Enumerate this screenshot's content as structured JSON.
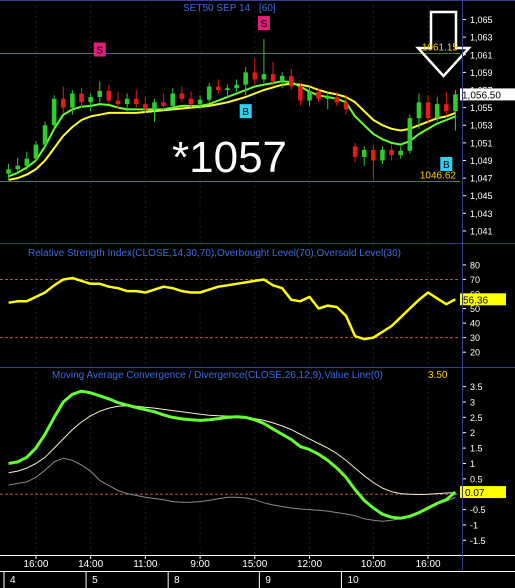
{
  "colors": {
    "background": "#000000",
    "frame": "#3a3f8f",
    "price_candle_up": "#2ecc2e",
    "price_candle_down": "#e61a1a",
    "ma_fast": "#66ff33",
    "ma_slow": "#ffff33",
    "level_line": "#4b5bd6",
    "rsi_line": "#ffff00",
    "rsi_level": "#b55050",
    "macd_line": "#66ff33",
    "macd_signal": "#f2f2d0",
    "macd_hist": "#8a8a8a",
    "title_text": "#3d6be0",
    "axis_text": "#ffffff",
    "grid": "#202020",
    "sell_marker": "#e0207a",
    "buy_marker": "#30d0f0",
    "value_badge_bg": "#ffff00",
    "value_badge_text": "#000000"
  },
  "chart_data": [
    {
      "id": "price",
      "type": "candlestick",
      "title": "SET50 SEP 14",
      "interval_label": "[60]",
      "ylim": [
        1040.2,
        1065.4
      ],
      "yticks": [
        "1,065",
        "1,063",
        "1,061",
        "1,059",
        "1,057",
        "1,055",
        "1,053",
        "1,051",
        "1,049",
        "1,047",
        "1,045",
        "1,043",
        "1,041"
      ],
      "ytick_values": [
        1065,
        1063,
        1061,
        1059,
        1057,
        1055,
        1053,
        1051,
        1049,
        1047,
        1045,
        1043,
        1041
      ],
      "upper_level": 1061.15,
      "upper_level_label": "1061.15",
      "lower_level": 1046.62,
      "lower_level_label": "1046.62",
      "last_value_label": "1,056.50",
      "big_annotation": "*1057",
      "candles": [
        {
          "o": 1047.5,
          "h": 1048.6,
          "l": 1046.9,
          "c": 1048.0
        },
        {
          "o": 1048.0,
          "h": 1049.3,
          "l": 1047.5,
          "c": 1048.4
        },
        {
          "o": 1048.4,
          "h": 1050.0,
          "l": 1047.9,
          "c": 1049.2
        },
        {
          "o": 1049.2,
          "h": 1051.2,
          "l": 1048.9,
          "c": 1050.8
        },
        {
          "o": 1050.8,
          "h": 1053.4,
          "l": 1050.3,
          "c": 1053.0
        },
        {
          "o": 1053.0,
          "h": 1056.4,
          "l": 1052.6,
          "c": 1056.0
        },
        {
          "o": 1056.0,
          "h": 1057.4,
          "l": 1054.4,
          "c": 1055.0
        },
        {
          "o": 1055.0,
          "h": 1057.0,
          "l": 1054.2,
          "c": 1056.6
        },
        {
          "o": 1056.6,
          "h": 1057.2,
          "l": 1055.0,
          "c": 1055.6
        },
        {
          "o": 1055.6,
          "h": 1056.6,
          "l": 1054.6,
          "c": 1056.2
        },
        {
          "o": 1056.2,
          "h": 1058.0,
          "l": 1055.6,
          "c": 1056.9
        },
        {
          "o": 1056.9,
          "h": 1057.6,
          "l": 1055.4,
          "c": 1055.8
        },
        {
          "o": 1055.8,
          "h": 1056.8,
          "l": 1054.8,
          "c": 1055.4
        },
        {
          "o": 1055.4,
          "h": 1056.6,
          "l": 1054.6,
          "c": 1056.0
        },
        {
          "o": 1056.0,
          "h": 1057.0,
          "l": 1055.0,
          "c": 1055.4
        },
        {
          "o": 1055.4,
          "h": 1056.2,
          "l": 1054.4,
          "c": 1054.8
        },
        {
          "o": 1054.8,
          "h": 1056.0,
          "l": 1053.4,
          "c": 1055.6
        },
        {
          "o": 1055.6,
          "h": 1056.6,
          "l": 1054.8,
          "c": 1055.2
        },
        {
          "o": 1055.2,
          "h": 1057.2,
          "l": 1054.9,
          "c": 1056.6
        },
        {
          "o": 1056.6,
          "h": 1057.4,
          "l": 1055.6,
          "c": 1056.0
        },
        {
          "o": 1056.0,
          "h": 1056.8,
          "l": 1055.0,
          "c": 1055.4
        },
        {
          "o": 1055.4,
          "h": 1056.4,
          "l": 1054.8,
          "c": 1055.9
        },
        {
          "o": 1055.9,
          "h": 1057.8,
          "l": 1055.6,
          "c": 1057.4
        },
        {
          "o": 1057.4,
          "h": 1058.2,
          "l": 1056.6,
          "c": 1057.0
        },
        {
          "o": 1057.0,
          "h": 1057.6,
          "l": 1056.2,
          "c": 1057.2
        },
        {
          "o": 1057.2,
          "h": 1058.2,
          "l": 1056.8,
          "c": 1057.6
        },
        {
          "o": 1057.6,
          "h": 1059.6,
          "l": 1056.4,
          "c": 1059.0
        },
        {
          "o": 1059.0,
          "h": 1060.6,
          "l": 1057.6,
          "c": 1058.2
        },
        {
          "o": 1058.2,
          "h": 1062.8,
          "l": 1057.8,
          "c": 1058.8
        },
        {
          "o": 1058.8,
          "h": 1060.2,
          "l": 1057.4,
          "c": 1058.0
        },
        {
          "o": 1058.0,
          "h": 1059.0,
          "l": 1057.2,
          "c": 1058.6
        },
        {
          "o": 1058.6,
          "h": 1059.4,
          "l": 1057.0,
          "c": 1057.4
        },
        {
          "o": 1057.4,
          "h": 1057.8,
          "l": 1055.2,
          "c": 1055.8
        },
        {
          "o": 1055.8,
          "h": 1057.4,
          "l": 1055.2,
          "c": 1056.8
        },
        {
          "o": 1056.8,
          "h": 1057.2,
          "l": 1055.6,
          "c": 1056.0
        },
        {
          "o": 1056.0,
          "h": 1056.8,
          "l": 1054.8,
          "c": 1056.2
        },
        {
          "o": 1056.2,
          "h": 1056.8,
          "l": 1055.2,
          "c": 1055.6
        },
        {
          "o": 1055.6,
          "h": 1056.4,
          "l": 1054.2,
          "c": 1054.8
        },
        {
          "o": 1050.6,
          "h": 1051.0,
          "l": 1048.8,
          "c": 1049.4
        },
        {
          "o": 1049.4,
          "h": 1050.6,
          "l": 1048.4,
          "c": 1050.2
        },
        {
          "o": 1050.2,
          "h": 1050.8,
          "l": 1046.8,
          "c": 1049.0
        },
        {
          "o": 1049.0,
          "h": 1050.6,
          "l": 1048.6,
          "c": 1050.2
        },
        {
          "o": 1050.2,
          "h": 1050.8,
          "l": 1049.0,
          "c": 1049.6
        },
        {
          "o": 1049.6,
          "h": 1050.6,
          "l": 1049.2,
          "c": 1050.1
        },
        {
          "o": 1050.1,
          "h": 1054.2,
          "l": 1049.8,
          "c": 1053.8
        },
        {
          "o": 1053.8,
          "h": 1056.6,
          "l": 1052.6,
          "c": 1055.6
        },
        {
          "o": 1055.6,
          "h": 1056.4,
          "l": 1053.2,
          "c": 1053.8
        },
        {
          "o": 1053.8,
          "h": 1056.2,
          "l": 1053.4,
          "c": 1055.4
        },
        {
          "o": 1055.4,
          "h": 1056.8,
          "l": 1054.0,
          "c": 1054.6
        },
        {
          "o": 1054.6,
          "h": 1057.0,
          "l": 1052.4,
          "c": 1056.5
        }
      ],
      "ma_fast": [
        1047.2,
        1047.6,
        1048.2,
        1049.0,
        1050.6,
        1052.6,
        1054.2,
        1054.8,
        1055.1,
        1055.2,
        1055.4,
        1055.3,
        1055.0,
        1054.8,
        1054.8,
        1054.8,
        1054.8,
        1054.8,
        1055.0,
        1055.2,
        1055.2,
        1055.2,
        1055.4,
        1055.8,
        1056.2,
        1056.6,
        1057.0,
        1057.4,
        1057.6,
        1057.8,
        1058.0,
        1057.9,
        1057.4,
        1056.8,
        1056.4,
        1056.2,
        1056.0,
        1055.6,
        1054.0,
        1053.0,
        1052.0,
        1051.4,
        1051.0,
        1050.8,
        1051.2,
        1052.0,
        1052.6,
        1053.2,
        1053.6,
        1054.0
      ],
      "ma_slow": [
        1046.8,
        1047.0,
        1047.4,
        1048.0,
        1049.0,
        1050.4,
        1051.8,
        1052.8,
        1053.6,
        1054.0,
        1054.2,
        1054.4,
        1054.4,
        1054.4,
        1054.4,
        1054.5,
        1054.6,
        1054.7,
        1054.8,
        1054.9,
        1055.0,
        1055.1,
        1055.2,
        1055.4,
        1055.6,
        1055.9,
        1056.2,
        1056.6,
        1057.0,
        1057.3,
        1057.6,
        1057.7,
        1057.6,
        1057.4,
        1057.0,
        1056.7,
        1056.5,
        1056.2,
        1055.6,
        1054.6,
        1053.6,
        1053.0,
        1052.6,
        1052.4,
        1052.6,
        1053.0,
        1053.4,
        1053.8,
        1054.0,
        1054.4
      ],
      "markers": [
        {
          "index": 10,
          "price": 1061.6,
          "kind": "sell",
          "label": "S"
        },
        {
          "index": 28,
          "price": 1064.6,
          "kind": "sell",
          "label": "S"
        },
        {
          "index": 26,
          "price": 1054.6,
          "kind": "buy",
          "label": "B"
        },
        {
          "index": 48,
          "price": 1048.6,
          "kind": "buy",
          "label": "B"
        }
      ]
    },
    {
      "id": "rsi",
      "type": "line",
      "title": "Relative Strength Index(CLOSE,14,30,70),Overbought Level(70),Oversold Level(30)",
      "ylim": [
        16,
        82
      ],
      "yticks": [
        "80",
        "70",
        "60",
        "50",
        "40",
        "30",
        "20"
      ],
      "ytick_values": [
        80,
        70,
        60,
        50,
        40,
        30,
        20
      ],
      "levels": [
        70,
        30
      ],
      "last_value_label": "56.36",
      "values": [
        54,
        55,
        55,
        58,
        61,
        66,
        70,
        71,
        69,
        67,
        67,
        65,
        64,
        62,
        62,
        61,
        63,
        65,
        64,
        62,
        61,
        61,
        63,
        65,
        66,
        67,
        68,
        69,
        70,
        66,
        64,
        56,
        55,
        58,
        50,
        52,
        51,
        45,
        31,
        29,
        30,
        34,
        38,
        44,
        50,
        56,
        61,
        57,
        53,
        56.36
      ]
    },
    {
      "id": "macd",
      "type": "line",
      "title": "Moving Average Convergence / Divergence(CLOSE,26,12,9),Value Line(0)",
      "header_value": "3.50",
      "ylim": [
        -1.75,
        3.65
      ],
      "yticks": [
        "3.5",
        "3",
        "2.5",
        "2",
        "1.5",
        "1",
        "0.5",
        "0",
        "-0.5",
        "-1",
        "-1.5"
      ],
      "ytick_values": [
        3.5,
        3,
        2.5,
        2,
        1.5,
        1,
        0.5,
        0,
        -0.5,
        -1,
        -1.5
      ],
      "zero_line": 0,
      "last_value_label": "0.07",
      "macd": [
        1.0,
        1.05,
        1.2,
        1.5,
        1.95,
        2.5,
        3.0,
        3.25,
        3.35,
        3.3,
        3.2,
        3.1,
        2.98,
        2.9,
        2.82,
        2.75,
        2.68,
        2.58,
        2.5,
        2.45,
        2.42,
        2.4,
        2.42,
        2.46,
        2.5,
        2.52,
        2.5,
        2.42,
        2.3,
        2.12,
        1.95,
        1.78,
        1.55,
        1.45,
        1.3,
        1.1,
        0.85,
        0.55,
        0.15,
        -0.2,
        -0.45,
        -0.65,
        -0.75,
        -0.78,
        -0.72,
        -0.6,
        -0.45,
        -0.3,
        -0.18,
        0.07
      ],
      "signal": [
        0.7,
        0.75,
        0.85,
        1.0,
        1.2,
        1.5,
        1.8,
        2.1,
        2.35,
        2.55,
        2.7,
        2.8,
        2.86,
        2.88,
        2.86,
        2.83,
        2.8,
        2.76,
        2.72,
        2.68,
        2.64,
        2.6,
        2.57,
        2.55,
        2.54,
        2.53,
        2.5,
        2.46,
        2.4,
        2.32,
        2.22,
        2.1,
        1.95,
        1.8,
        1.65,
        1.5,
        1.32,
        1.1,
        0.85,
        0.6,
        0.38,
        0.2,
        0.08,
        0.02,
        0.0,
        -0.01,
        0.0,
        0.02,
        0.04,
        0.05
      ],
      "histogram": [
        0.3,
        0.35,
        0.4,
        0.55,
        0.78,
        1.05,
        1.17,
        1.1,
        0.95,
        0.75,
        0.45,
        0.28,
        0.12,
        0.02,
        -0.04,
        -0.1,
        -0.14,
        -0.18,
        -0.24,
        -0.26,
        -0.26,
        -0.24,
        -0.2,
        -0.15,
        -0.1,
        -0.1,
        -0.12,
        -0.18,
        -0.28,
        -0.35,
        -0.4,
        -0.45,
        -0.48,
        -0.5,
        -0.52,
        -0.55,
        -0.6,
        -0.64,
        -0.7,
        -0.8,
        -0.85,
        -0.88,
        -0.85,
        -0.8,
        -0.72,
        -0.6,
        -0.45,
        -0.32,
        -0.22,
        -0.1
      ]
    }
  ],
  "time_axis": {
    "hour_labels": [
      {
        "label": "16:00",
        "index": 3
      },
      {
        "label": "14:00",
        "index": 9
      },
      {
        "label": "11:00",
        "index": 15
      },
      {
        "label": "9:00",
        "index": 21
      },
      {
        "label": "15:00",
        "index": 27
      },
      {
        "label": "12:00",
        "index": 33
      },
      {
        "label": "10:00",
        "index": 40
      },
      {
        "label": "16:00",
        "index": 46
      }
    ],
    "day_labels": [
      {
        "label": "4",
        "index": 0
      },
      {
        "label": "5",
        "index": 9
      },
      {
        "label": "8",
        "index": 18
      },
      {
        "label": "9",
        "index": 28
      },
      {
        "label": "10",
        "index": 37
      }
    ]
  }
}
